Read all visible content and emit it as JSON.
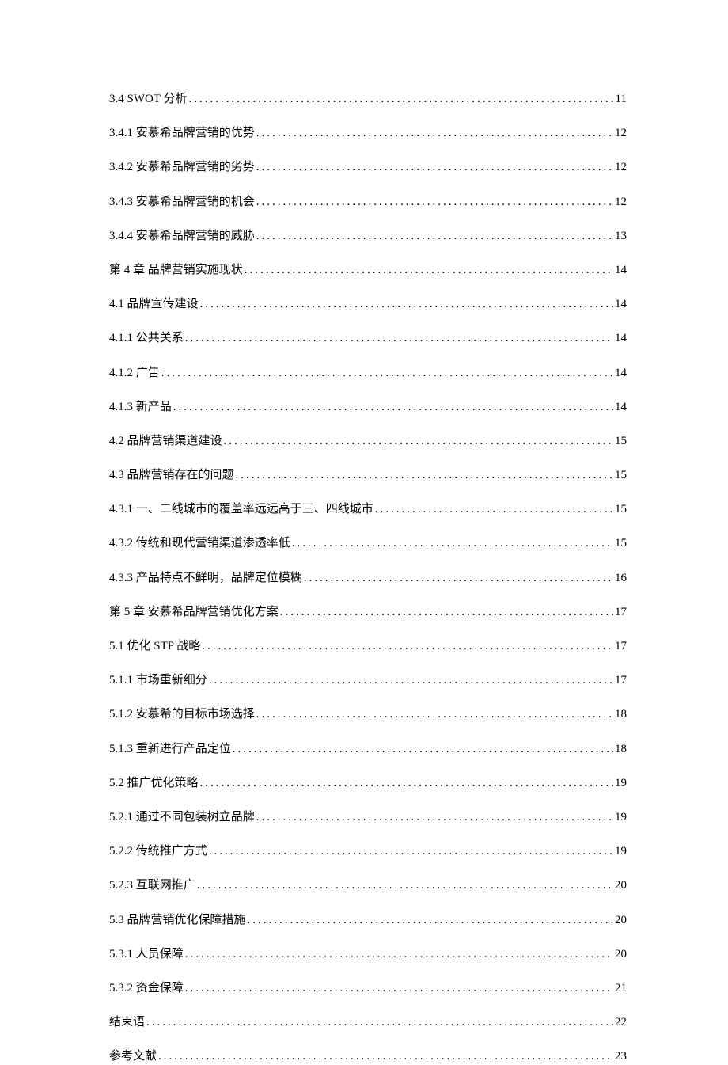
{
  "toc": [
    {
      "label": "3.4 SWOT 分析",
      "page": "11"
    },
    {
      "label": "3.4.1 安慕希品牌营销的优势",
      "page": "12"
    },
    {
      "label": "3.4.2 安慕希品牌营销的劣势",
      "page": "12"
    },
    {
      "label": "3.4.3 安慕希品牌营销的机会",
      "page": "12"
    },
    {
      "label": "3.4.4 安慕希品牌营销的威胁",
      "page": "13"
    },
    {
      "label": "第 4 章 品牌营销实施现状",
      "page": "14"
    },
    {
      "label": "4.1 品牌宣传建设",
      "page": "14"
    },
    {
      "label": "4.1.1 公共关系",
      "page": "14"
    },
    {
      "label": "4.1.2 广告 ",
      "page": "14"
    },
    {
      "label": "4.1.3 新产品",
      "page": "14"
    },
    {
      "label": "4.2 品牌营销渠道建设",
      "page": "15"
    },
    {
      "label": "4.3 品牌营销存在的问题",
      "page": "15"
    },
    {
      "label": "4.3.1 一、二线城市的覆盖率远远高于三、四线城市",
      "page": "15"
    },
    {
      "label": "4.3.2 传统和现代营销渠道渗透率低",
      "page": "15"
    },
    {
      "label": "4.3.3 产品特点不鲜明，品牌定位模糊",
      "page": "16"
    },
    {
      "label": "第 5 章 安慕希品牌营销优化方案",
      "page": "17"
    },
    {
      "label": "5.1 优化 STP 战略",
      "page": "17"
    },
    {
      "label": "5.1.1 市场重新细分",
      "page": "17"
    },
    {
      "label": "5.1.2 安慕希的目标市场选择",
      "page": "18"
    },
    {
      "label": "5.1.3 重新进行产品定位",
      "page": "18"
    },
    {
      "label": "5.2 推广优化策略",
      "page": "19"
    },
    {
      "label": "5.2.1 通过不同包装树立品牌",
      "page": "19"
    },
    {
      "label": "5.2.2 传统推广方式",
      "page": "19"
    },
    {
      "label": "5.2.3 互联网推广",
      "page": "20"
    },
    {
      "label": "5.3 品牌营销优化保障措施",
      "page": "20"
    },
    {
      "label": "5.3.1 人员保障",
      "page": "20"
    },
    {
      "label": "5.3.2 资金保障",
      "page": "21"
    },
    {
      "label": "结束语",
      "page": "22"
    },
    {
      "label": "参考文献",
      "page": "23"
    }
  ]
}
